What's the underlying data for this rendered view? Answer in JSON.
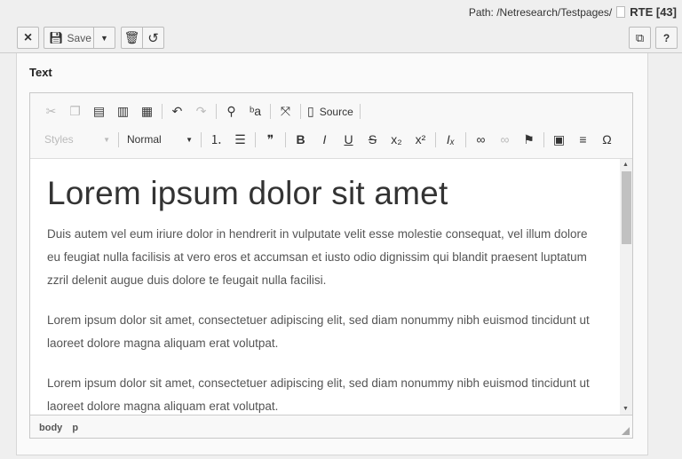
{
  "header": {
    "path_label": "Path: /Netresearch/Testpages/",
    "page_title": "RTE [43]"
  },
  "buttons": {
    "close": "×",
    "save": "Save",
    "open_new_window_icon": "external-link-icon",
    "help": "?"
  },
  "panel": {
    "title": "Text"
  },
  "toolbar": {
    "row1": [
      {
        "name": "cut",
        "glyph": "✂",
        "disabled": true
      },
      {
        "name": "copy",
        "glyph": "❐",
        "disabled": true
      },
      {
        "name": "paste",
        "glyph": "▤"
      },
      {
        "name": "paste-text",
        "glyph": "▥"
      },
      {
        "name": "paste-word",
        "glyph": "▦"
      },
      "|",
      {
        "name": "undo",
        "glyph": "↶"
      },
      {
        "name": "redo",
        "glyph": "↷",
        "disabled": true
      },
      "|",
      {
        "name": "find",
        "glyph": "⚲"
      },
      {
        "name": "replace",
        "glyph": "ᵇa"
      },
      "|",
      {
        "name": "maximize",
        "glyph": "⤧"
      },
      "|",
      {
        "name": "source",
        "glyph": "▯",
        "label": "Source"
      },
      "|"
    ],
    "styles": "Styles",
    "format": "Normal",
    "row2": [
      {
        "name": "numbered-list",
        "glyph": "⒈"
      },
      {
        "name": "bulleted-list",
        "glyph": "☰"
      },
      "|",
      {
        "name": "blockquote",
        "glyph": "❞"
      },
      "|",
      {
        "name": "bold",
        "glyph": "B"
      },
      {
        "name": "italic",
        "glyph": "I"
      },
      {
        "name": "underline",
        "glyph": "U"
      },
      {
        "name": "strike",
        "glyph": "S"
      },
      {
        "name": "subscript",
        "glyph": "x₂"
      },
      {
        "name": "superscript",
        "glyph": "x²"
      },
      "|",
      {
        "name": "remove-format",
        "glyph": "Iₓ"
      },
      "|",
      {
        "name": "link",
        "glyph": "∞"
      },
      {
        "name": "unlink",
        "glyph": "∞",
        "disabled": true
      },
      {
        "name": "anchor",
        "glyph": "⚑"
      },
      "|",
      {
        "name": "image",
        "glyph": "▣"
      },
      {
        "name": "horizontal-rule",
        "glyph": "≡"
      },
      {
        "name": "special-char",
        "glyph": "Ω"
      }
    ]
  },
  "content": {
    "heading": "Lorem ipsum dolor sit amet",
    "paragraphs": [
      "Duis autem vel eum iriure dolor in hendrerit in vulputate velit esse molestie consequat, vel illum dolore eu feugiat nulla facilisis at vero eros et accumsan et iusto odio dignissim qui blandit praesent luptatum zzril delenit augue duis dolore te feugait nulla facilisi.",
      "Lorem ipsum dolor sit amet, consectetuer adipiscing elit, sed diam nonummy nibh euismod tincidunt ut laoreet dolore magna aliquam erat volutpat.",
      "Lorem ipsum dolor sit amet, consectetuer adipiscing elit, sed diam nonummy nibh euismod tincidunt ut laoreet dolore magna aliquam erat volutpat."
    ]
  },
  "elementpath": [
    "body",
    "p"
  ]
}
